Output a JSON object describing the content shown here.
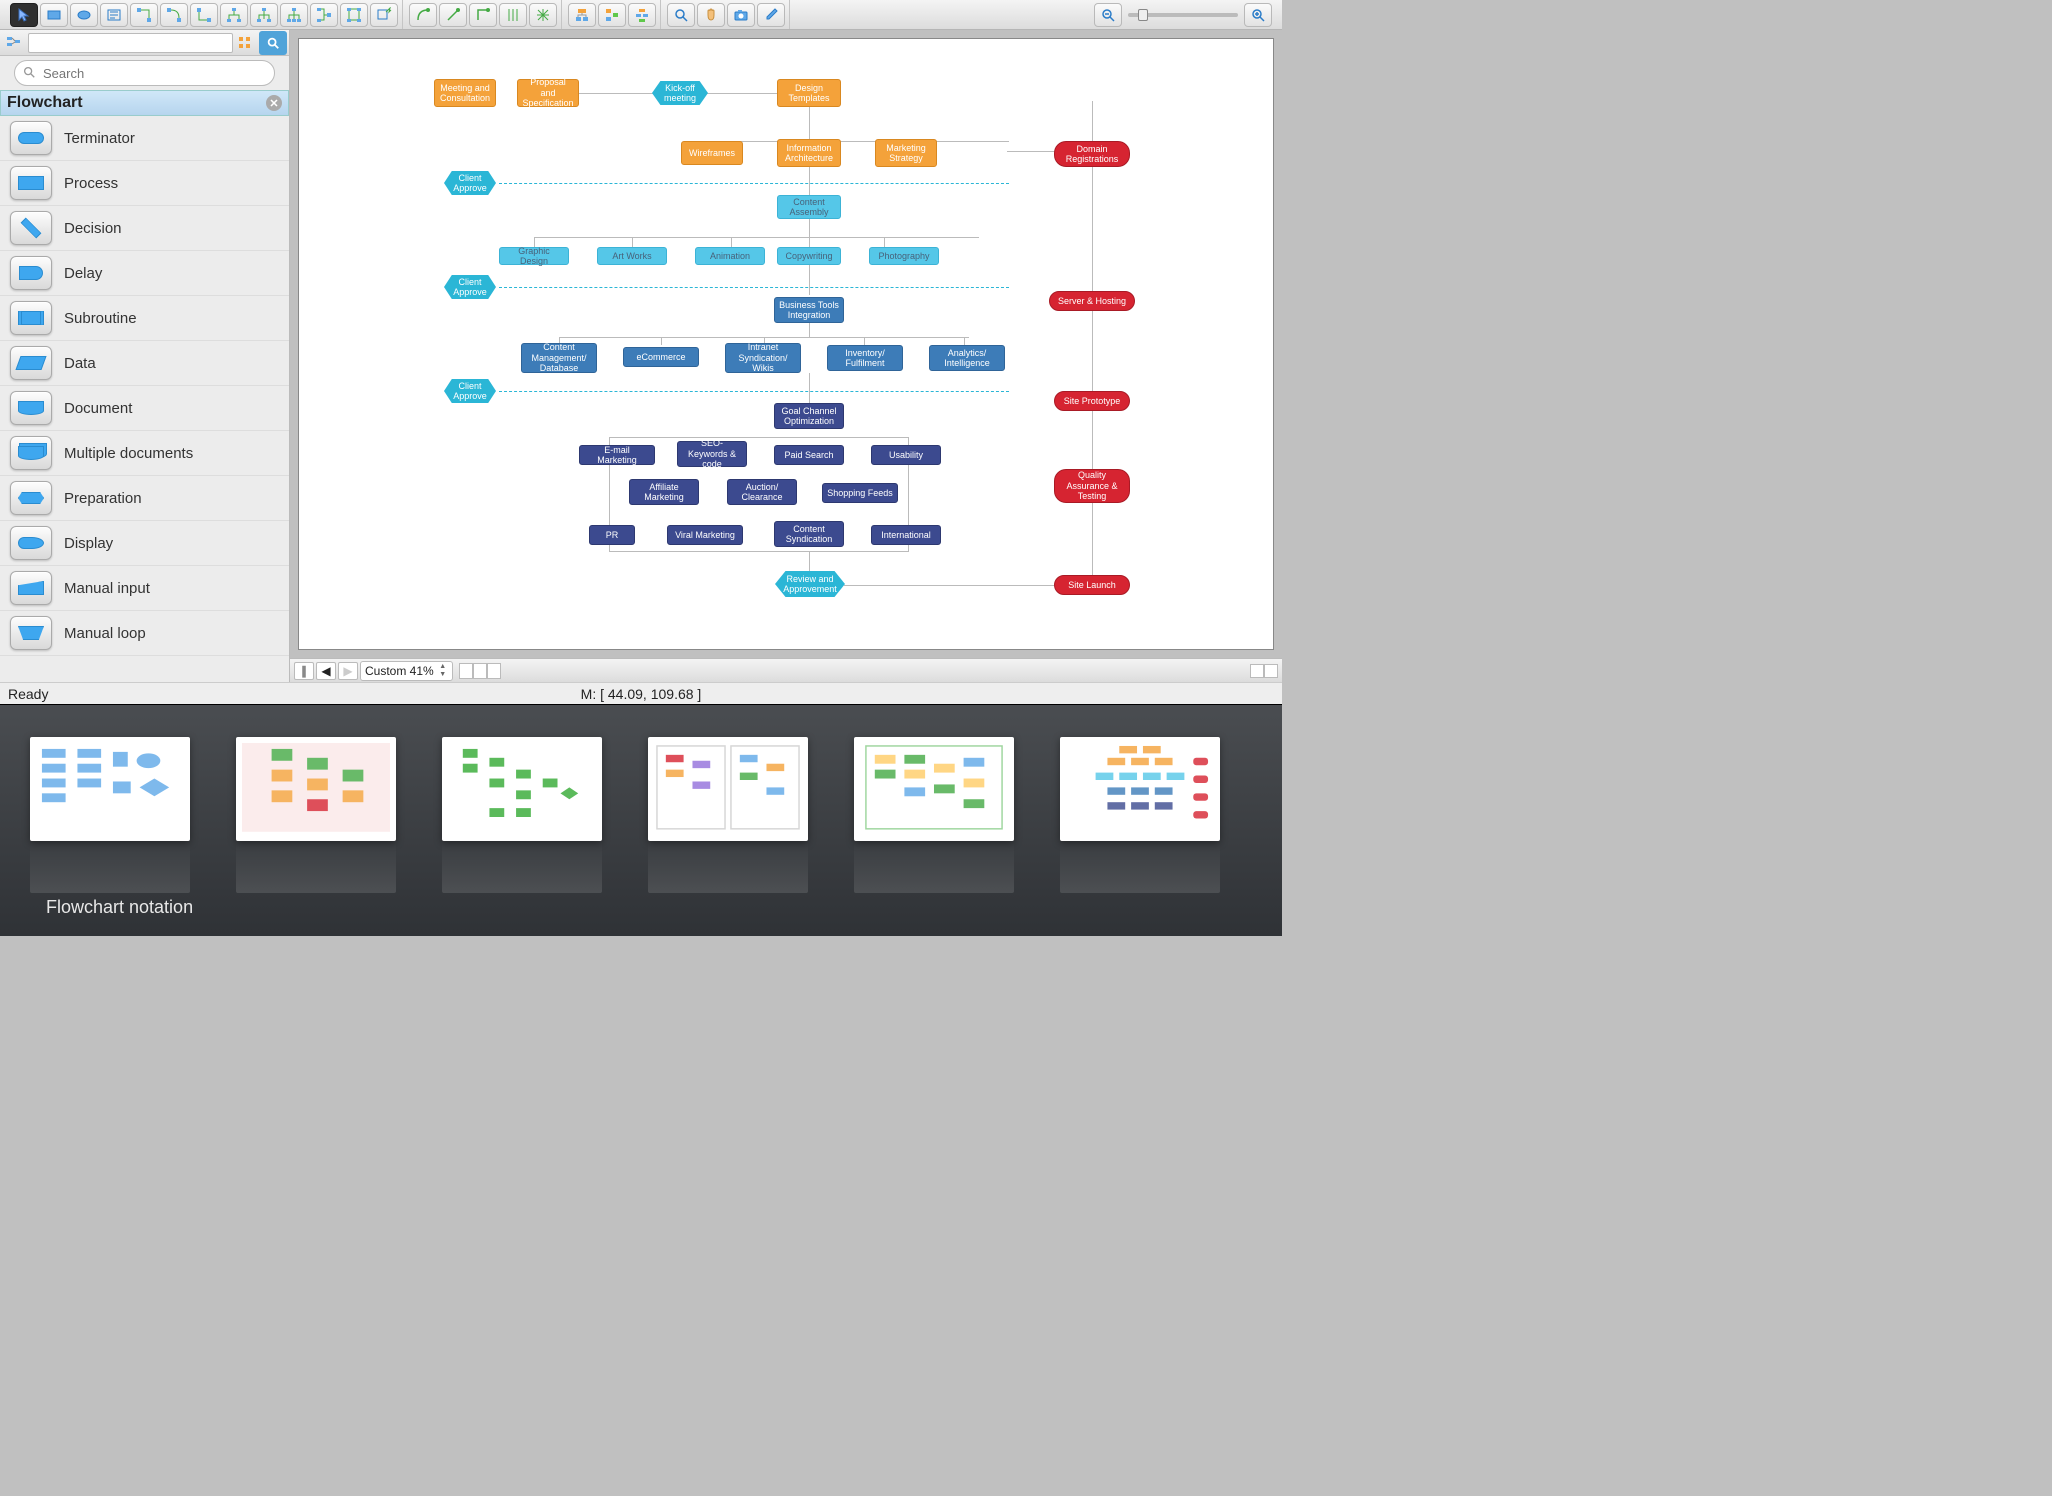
{
  "toolbar": {
    "groups": [
      [
        "pointer",
        "rectangle",
        "ellipse",
        "text",
        "connector-straight",
        "connector-elbow",
        "connector-curve",
        "connector-tree1",
        "connector-tree2",
        "connector-tree3",
        "connector-tree4",
        "connector-multidrop",
        "insert-shape"
      ],
      [
        "smart-connector-1",
        "smart-connector-2",
        "smart-connector-3",
        "align-1",
        "align-2"
      ],
      [
        "group-1",
        "group-2",
        "group-3"
      ],
      [
        "zoom-tool",
        "pan-tool",
        "snapshot-tool",
        "eyedropper"
      ],
      [
        "zoom-out",
        "zoom-slider",
        "zoom-in"
      ]
    ]
  },
  "library": {
    "search_placeholder": "Search",
    "section_title": "Flowchart",
    "shapes": [
      {
        "name": "Terminator",
        "shape": "terminator"
      },
      {
        "name": "Process",
        "shape": "process"
      },
      {
        "name": "Decision",
        "shape": "decision"
      },
      {
        "name": "Delay",
        "shape": "delay"
      },
      {
        "name": "Subroutine",
        "shape": "subroutine"
      },
      {
        "name": "Data",
        "shape": "data"
      },
      {
        "name": "Document",
        "shape": "document"
      },
      {
        "name": "Multiple documents",
        "shape": "multidoc"
      },
      {
        "name": "Preparation",
        "shape": "preparation"
      },
      {
        "name": "Display",
        "shape": "display"
      },
      {
        "name": "Manual input",
        "shape": "manualinput"
      },
      {
        "name": "Manual loop",
        "shape": "manualloop"
      }
    ]
  },
  "canvas": {
    "zoom_label": "Custom 41%",
    "nodes": {
      "meeting": "Meeting and\nConsultation",
      "proposal": "Proposal and\nSpecification",
      "kickoff": "Kick-off\nmeeting",
      "design_templates": "Design\nTemplates",
      "wireframes": "Wireframes",
      "info_arch": "Information\nArchitecture",
      "marketing": "Marketing\nStrategy",
      "approve1": "Client\nApprove",
      "content_assembly": "Content\nAssembly",
      "graphic": "Graphic Design",
      "artworks": "Art Works",
      "animation": "Animation",
      "copywriting": "Copywriting",
      "photography": "Photography",
      "approve2": "Client\nApprove",
      "biztools": "Business Tools\nIntegration",
      "cms": "Content\nManagement/\nDatabase",
      "ecommerce": "eCommerce",
      "intranet": "Intranet\nSyndication/\nWikis",
      "inventory": "Inventory/\nFulfilment",
      "analytics": "Analytics/\nIntelligence",
      "approve3": "Client\nApprove",
      "goal": "Goal Channel\nOptimization",
      "email_mkt": "E-mail Marketing",
      "seo": "SEO-Keywords &\ncode",
      "paid": "Paid Search",
      "usability": "Usability",
      "affiliate": "Affiliate\nMarketing",
      "auction": "Auction/\nClearance",
      "feeds": "Shopping Feeds",
      "pr": "PR",
      "viral": "Viral Marketing",
      "csyn": "Content\nSyndication",
      "intl": "International",
      "review": "Review and\nApprovement",
      "domain_reg": "Domain\nRegistrations",
      "hosting": "Server & Hosting",
      "prototype": "Site Prototype",
      "qa": "Quality\nAssurance &\nTesting",
      "launch": "Site Launch"
    }
  },
  "status": {
    "ready": "Ready",
    "mouse": "M: [ 44.09, 109.68 ]"
  },
  "gallery": {
    "caption": "Flowchart notation"
  }
}
